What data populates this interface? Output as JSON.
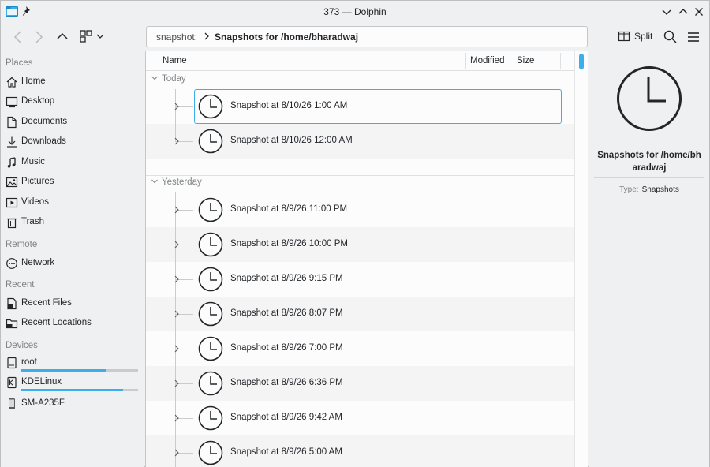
{
  "window": {
    "title": "373 — Dolphin"
  },
  "toolbar": {
    "location": {
      "scheme": "snapshot:",
      "path": "Snapshots for /home/bharadwaj"
    },
    "split_label": "Split"
  },
  "sidebar": {
    "sections": [
      {
        "title": "Places",
        "items": [
          {
            "label": "Home",
            "icon": "home-icon"
          },
          {
            "label": "Desktop",
            "icon": "desktop-icon"
          },
          {
            "label": "Documents",
            "icon": "documents-icon"
          },
          {
            "label": "Downloads",
            "icon": "downloads-icon"
          },
          {
            "label": "Music",
            "icon": "music-icon"
          },
          {
            "label": "Pictures",
            "icon": "pictures-icon"
          },
          {
            "label": "Videos",
            "icon": "videos-icon"
          },
          {
            "label": "Trash",
            "icon": "trash-icon"
          }
        ]
      },
      {
        "title": "Remote",
        "items": [
          {
            "label": "Network",
            "icon": "network-icon"
          }
        ]
      },
      {
        "title": "Recent",
        "items": [
          {
            "label": "Recent Files",
            "icon": "recent-files-icon"
          },
          {
            "label": "Recent Locations",
            "icon": "recent-locations-icon"
          }
        ]
      },
      {
        "title": "Devices",
        "items": [
          {
            "label": "root",
            "icon": "drive-icon",
            "usage": 0.72
          },
          {
            "label": "KDELinux",
            "icon": "drive-icon",
            "usage": 0.87
          },
          {
            "label": "SM-A235F",
            "icon": "phone-icon"
          }
        ]
      }
    ]
  },
  "view": {
    "columns": {
      "name": "Name",
      "modified": "Modified",
      "size": "Size"
    },
    "groups": [
      {
        "label": "Today",
        "items": [
          "Snapshot at 8/10/26 1:00 AM",
          "Snapshot at 8/10/26 12:00 AM"
        ]
      },
      {
        "label": "Yesterday",
        "items": [
          "Snapshot at 8/9/26 11:00 PM",
          "Snapshot at 8/9/26 10:00 PM",
          "Snapshot at 8/9/26 9:15 PM",
          "Snapshot at 8/9/26 8:07 PM",
          "Snapshot at 8/9/26 7:00 PM",
          "Snapshot at 8/9/26 6:36 PM",
          "Snapshot at 8/9/26 9:42 AM",
          "Snapshot at 8/9/26 5:00 AM"
        ]
      }
    ]
  },
  "info_panel": {
    "title": "Snapshots for /home/bharadwaj",
    "title_line1": "Snapshots for /home/bh",
    "title_line2": "aradwaj",
    "type_key": "Type:",
    "type_value": "Snapshots"
  },
  "colors": {
    "accent": "#3daee9",
    "text": "#232629",
    "muted": "#7f8385"
  }
}
